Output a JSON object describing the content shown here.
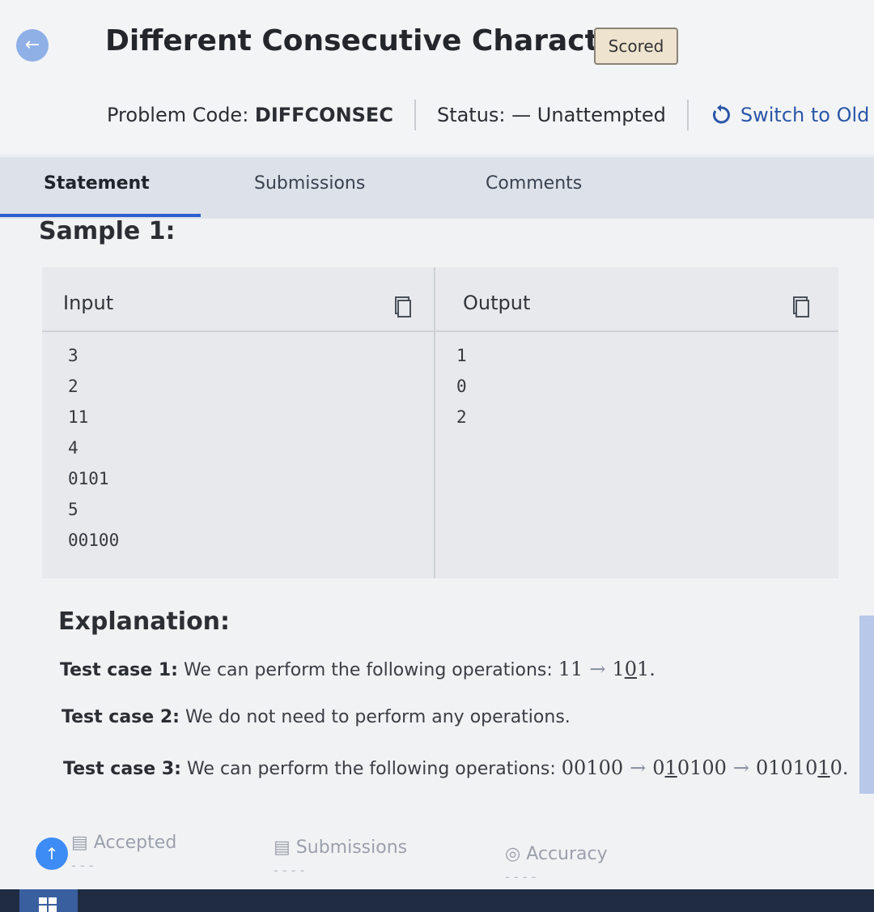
{
  "header": {
    "back_icon": "arrow-left-icon",
    "back_glyph": "←",
    "title": "Different Consecutive Characters",
    "badge": "Scored",
    "problem_code_label": "Problem Code: ",
    "problem_code": "DIFFCONSEC",
    "status_label": "Status: ",
    "status_value": "— Unattempted",
    "switch_icon": "undo-icon",
    "switch_label": "Switch to Old Co"
  },
  "tabs": [
    {
      "label": "Statement",
      "active": true
    },
    {
      "label": "Submissions",
      "active": false
    },
    {
      "label": "Comments",
      "active": false
    }
  ],
  "sample": {
    "title": "Sample 1:",
    "input_label": "Input",
    "output_label": "Output",
    "input_lines": [
      "3",
      "2",
      "11",
      "4",
      "0101",
      "5",
      "00100"
    ],
    "output_lines": [
      "1",
      "0",
      "2"
    ],
    "copy_icon": "copy-icon"
  },
  "explanation": {
    "title": "Explanation:",
    "case1_label": "Test case 1:",
    "case1_text": " We can perform the following operations: ",
    "case1_from": "11",
    "case1_to_a": "1",
    "case1_to_u": "0",
    "case1_to_b": "1.",
    "case2_label": "Test case 2:",
    "case2_text": " We do not need to perform any operations.",
    "case3_label": "Test case 3:",
    "case3_text": " We can perform the following operations: ",
    "case3_from": "00100",
    "case3_mid_a": "0",
    "case3_mid_u": "1",
    "case3_mid_b": "0100",
    "case3_to_a": "01010",
    "case3_to_u": "1",
    "case3_to_b": "0.",
    "arrow": "→"
  },
  "stats": {
    "fab_glyph": "↑",
    "accepted_label": "Accepted",
    "submissions_label": "Submissions",
    "accuracy_label": "Accuracy",
    "accepted_value": "- - -",
    "submissions_value": "- - - -",
    "accuracy_value": "- - - -"
  },
  "colors": {
    "accent": "#2e5fd1",
    "back_button": "#8fb0e6",
    "badge_bg": "#eee3cf",
    "taskbar": "#1f2c42"
  }
}
